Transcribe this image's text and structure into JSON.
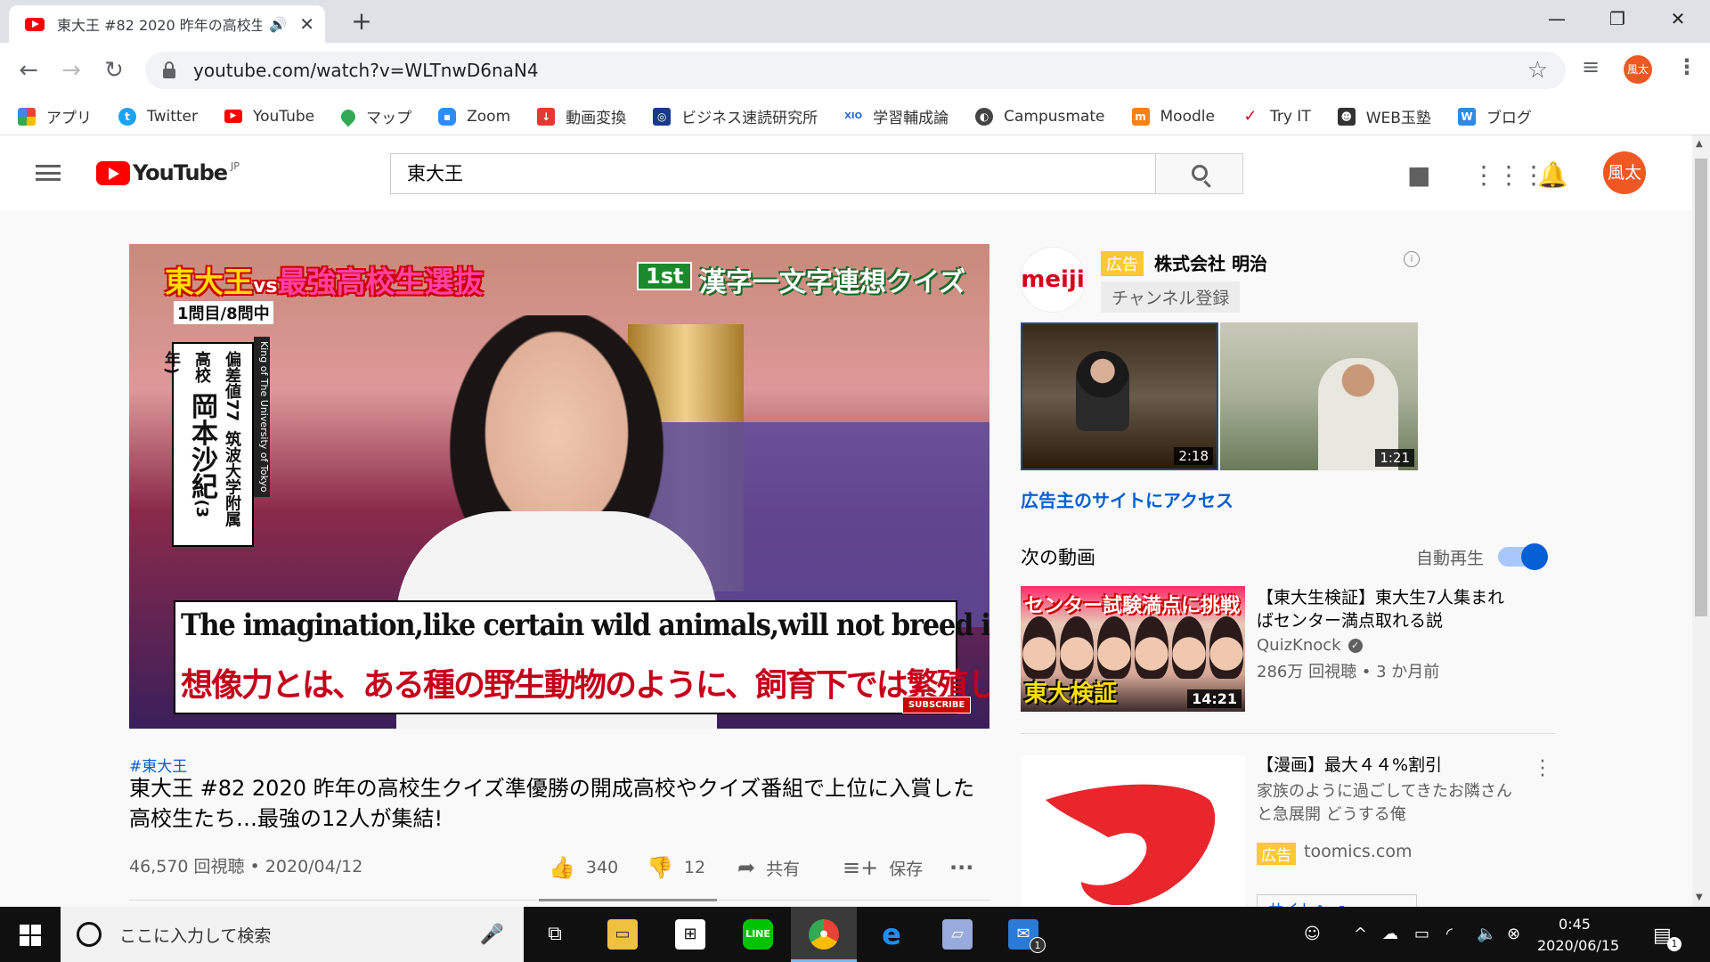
{
  "browser": {
    "tab_title": "東大王 #82 2020 昨年の高校生",
    "url": "youtube.com/watch?v=WLTnwD6naN4",
    "profile_initials": "風太",
    "bookmarks": [
      {
        "label": "アプリ",
        "icon": "apps-grid-icon",
        "color": "#4285f4"
      },
      {
        "label": "Twitter",
        "icon": "twitter-icon",
        "color": "#1da1f2"
      },
      {
        "label": "YouTube",
        "icon": "youtube-icon",
        "color": "#ff0000"
      },
      {
        "label": "マップ",
        "icon": "maps-pin-icon",
        "color": "#34a853"
      },
      {
        "label": "Zoom",
        "icon": "zoom-icon",
        "color": "#2d8cff"
      },
      {
        "label": "動画変換",
        "icon": "download-icon",
        "color": "#e53935"
      },
      {
        "label": "ビジネス速読研究所",
        "icon": "book-icon",
        "color": "#1a3a8a"
      },
      {
        "label": "学習輔成論",
        "icon": "xio-icon",
        "color": "#2a6ad6"
      },
      {
        "label": "Campusmate",
        "icon": "globe-icon",
        "color": "#444444"
      },
      {
        "label": "Moodle",
        "icon": "moodle-icon",
        "color": "#f98012"
      },
      {
        "label": "Try IT",
        "icon": "checkmark-icon",
        "color": "#d6001c"
      },
      {
        "label": "WEB玉塾",
        "icon": "mascot-icon",
        "color": "#333333"
      },
      {
        "label": "ブログ",
        "icon": "word-w-icon",
        "color": "#2b8ae6"
      }
    ]
  },
  "youtube": {
    "logo_text": "YouTube",
    "logo_region": "JP",
    "search_value": "東大王",
    "avatar_initials": "風太"
  },
  "video": {
    "overlay_title_a": "東大王",
    "overlay_title_vs": "vs",
    "overlay_title_b": "最強高校生選抜",
    "overlay_sub": "1問目/8問中",
    "overlay_round": "1st",
    "overlay_quiz": "漢字一文字連想クイズ",
    "overlay_name": "岡本沙紀",
    "overlay_grade": "(3年)",
    "overlay_school": "筑波大学附属高校",
    "overlay_dev": "偏差値77",
    "overlay_side": "King of The University of Tokyo",
    "caption_en": "The imagination,like certain wild animals,will not breed in captivity.",
    "caption_jp": "想像力とは、ある種の野生動物のように、飼育下では繁殖しないものだ",
    "subscribe": "SUBSCRIBE",
    "hashtag": "#東大王",
    "title": "東大王 #82 2020 昨年の高校生クイズ準優勝の開成高校やクイズ番組で上位に入賞した高校生たち…最強の12人が集結!",
    "views_date": "46,570 回視聴 • 2020/04/12",
    "likes": "340",
    "dislikes": "12",
    "share": "共有",
    "save": "保存"
  },
  "sidebar": {
    "ad": {
      "logo_text": "meiji",
      "badge": "広告",
      "name": "株式会社 明治",
      "subscribe": "チャンネル登録",
      "thumb1_duration": "2:18",
      "thumb2_duration": "1:21",
      "link": "広告主のサイトにアクセス"
    },
    "next_heading": "次の動画",
    "autoplay_label": "自動再生",
    "autoplay_on": true,
    "rec": {
      "thumb_top": "センター試験満点に挑戦",
      "thumb_bottom": "東大検証",
      "duration": "14:21",
      "title": "【東大生検証】東大生7人集まればセンター満点取れる説",
      "channel": "QuizKnock",
      "meta": "286万 回視聴 • 3 か月前"
    },
    "ad2": {
      "title": "【漫画】最大４４%割引",
      "desc": "家族のように過ごしてきたお隣さんと急展開 どうする俺",
      "badge": "広告",
      "domain": "toomics.com",
      "cta": "サイトへ"
    }
  },
  "taskbar": {
    "search_placeholder": "ここに入力して検索",
    "time": "0:45",
    "date": "2020/06/15",
    "mail_badge": "1",
    "notif_badge": "1"
  }
}
